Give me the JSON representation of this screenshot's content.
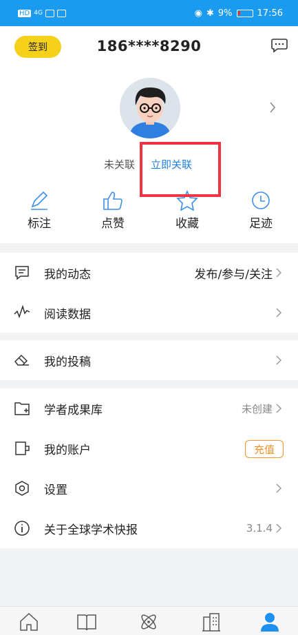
{
  "status_bar": {
    "carrier": "HD",
    "network": "4G",
    "battery": "9%",
    "time": "17:56"
  },
  "header": {
    "signin_label": "签到",
    "phone": "186****8290"
  },
  "profile": {
    "unlinked_label": "未关联",
    "link_now_label": "立即关联"
  },
  "quick_actions": [
    {
      "label": "标注",
      "icon": "pencil-icon"
    },
    {
      "label": "点赞",
      "icon": "thumbs-up-icon"
    },
    {
      "label": "收藏",
      "icon": "star-icon"
    },
    {
      "label": "足迹",
      "icon": "clock-icon"
    }
  ],
  "menu": {
    "my_activity": {
      "label": "我的动态",
      "value": "发布/参与/关注"
    },
    "read_data": {
      "label": "阅读数据"
    },
    "my_submission": {
      "label": "我的投稿"
    },
    "scholar_library": {
      "label": "学者成果库",
      "value": "未创建"
    },
    "my_account": {
      "label": "我的账户",
      "action": "充值"
    },
    "settings": {
      "label": "设置"
    },
    "about": {
      "label": "关于全球学术快报",
      "value": "3.1.4"
    }
  },
  "tabbar": [
    "home-icon",
    "book-icon",
    "atom-icon",
    "building-icon",
    "user-icon"
  ],
  "colors": {
    "accent": "#1f7fd8",
    "status_bar": "#1a9bef",
    "signin": "#f6d11b",
    "highlight_box": "#ef3340",
    "recharge": "#f19226"
  }
}
